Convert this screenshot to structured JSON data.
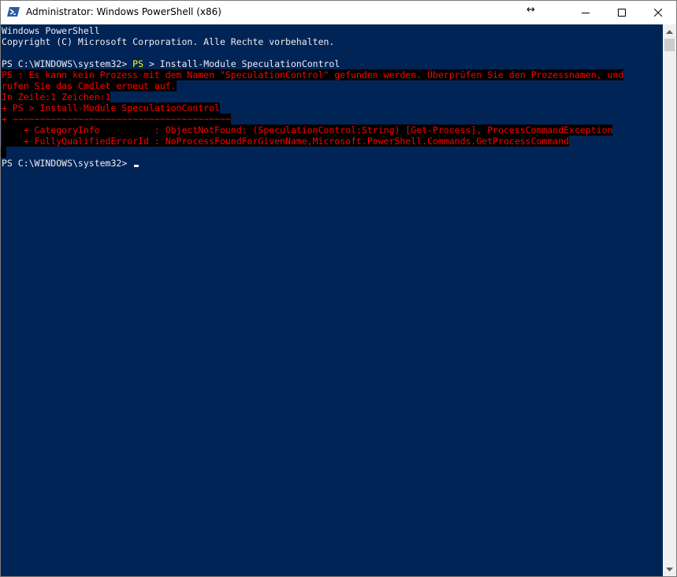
{
  "window": {
    "title": "Administrator: Windows PowerShell (x86)",
    "resize_glyph": "↔",
    "minimize_icon": "minimize-icon",
    "maximize_icon": "maximize-icon",
    "close_icon": "close-icon"
  },
  "colors": {
    "console_background": "#012456",
    "console_foreground": "#eeedf0",
    "error_foreground": "#ff0000",
    "error_background": "#000000",
    "highlight": "#ffff00"
  },
  "console": {
    "line1": "Windows PowerShell",
    "line2": "Copyright (C) Microsoft Corporation. Alle Rechte vorbehalten.",
    "prompt1": "PS C:\\WINDOWS\\system32> ",
    "cmd_highlight": "PS",
    "cmd_rest": " > Install-Module SpeculationControl",
    "err1": "PS : Es kann kein Prozess mit dem Namen \"SpeculationControl\" gefunden werden. Überprüfen Sie den Prozessnamen, und",
    "err2": "rufen Sie das Cmdlet erneut auf.",
    "err3": "In Zeile:1 Zeichen:1",
    "err4": "+ PS > Install-Module SpeculationControl",
    "err5": "+ ~~~~~~~~~~~~~~~~~~~~~~~~~~~~~~~~~~~~~~~~",
    "err6": "    + CategoryInfo          : ObjectNotFound: (SpeculationControl:String) [Get-Process], ProcessCommandException",
    "err7": "    + FullyQualifiedErrorId : NoProcessFoundForGivenName,Microsoft.PowerShell.Commands.GetProcessCommand",
    "prompt2": "PS C:\\WINDOWS\\system32> "
  }
}
